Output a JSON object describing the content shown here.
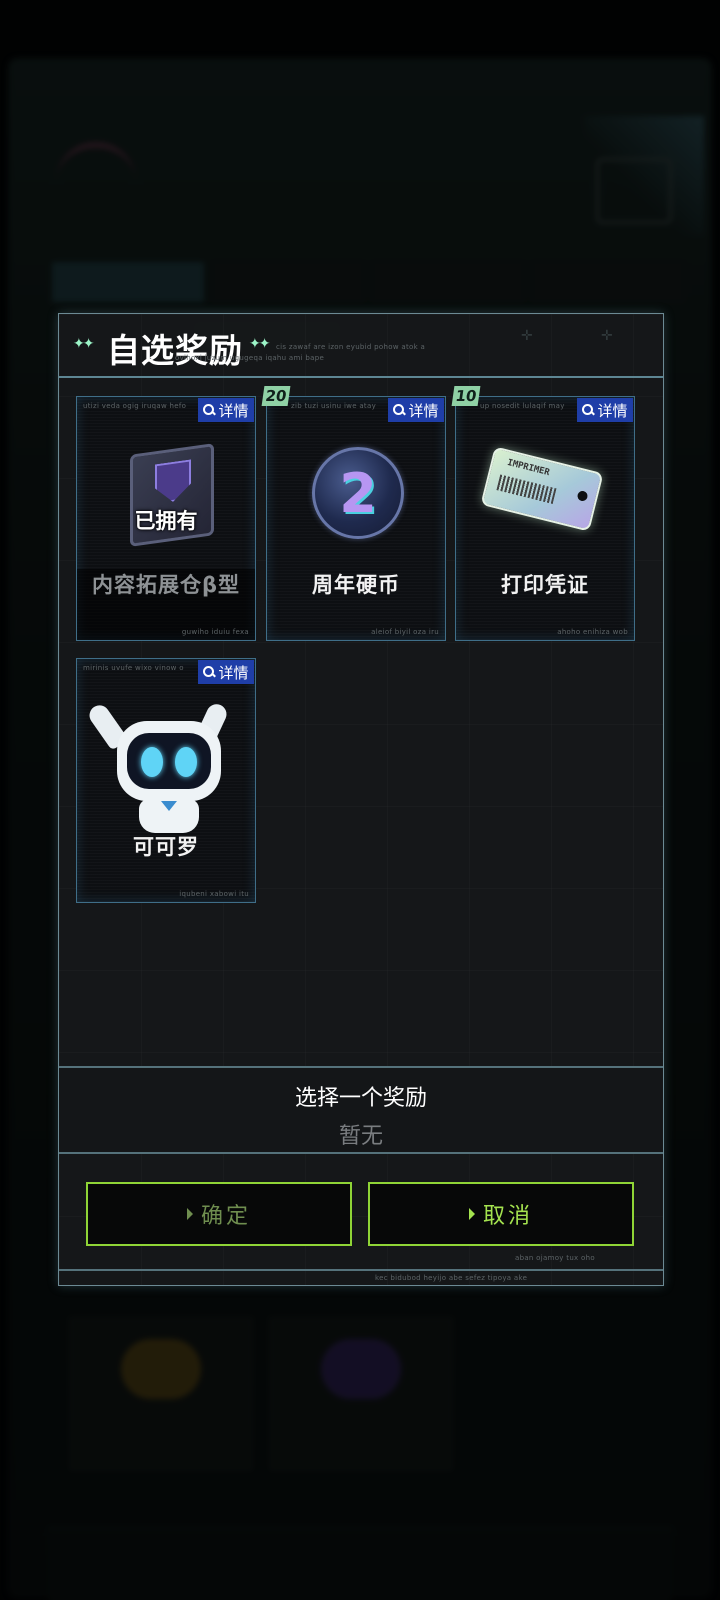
{
  "dialog": {
    "title": "自选奖励",
    "title_deco_left": "✦✦",
    "title_deco_right": "✦✦",
    "header_deco_line1": "cis zawaf are izon eyubid pohow atok a",
    "header_deco_line2": "ovihoxi juzum ugugeqa iqahu ami bape",
    "detail_label": "详情",
    "rewards": [
      {
        "name": "内容拓展仓β型",
        "status": "已拥有",
        "deco_top": "utizi veda ogig iruqaw hefo",
        "deco_bottom": "guwiho iduiu fexa"
      },
      {
        "name": "周年硬币",
        "quantity": "20",
        "coin_glyph": "2",
        "deco_top": "zib tuzi usinu iwe atay",
        "deco_bottom": "aleiof biyil oza iru"
      },
      {
        "name": "打印凭证",
        "quantity": "10",
        "ticket_text": "IMPRIMER",
        "deco_top": "up nosedit lulaqif may",
        "deco_bottom": "ahoho enihiza wob"
      },
      {
        "name": "可可罗",
        "deco_top": "mirinis uvufe wixo vinow o",
        "deco_bottom": "iqubeni xabowi itu"
      }
    ],
    "selection": {
      "label": "选择一个奖励",
      "value": "暂无"
    },
    "buttons": {
      "confirm": "确定",
      "cancel": "取消"
    },
    "footer_deco_line1": "aban ojamoy tux oho",
    "footer_deco_line2": "kec bidubod heyijo abe sefez tipoya ake"
  },
  "colors": {
    "accent_green": "#a4e34f",
    "border_cyan": "#6c8a94",
    "detail_blue": "#1f3ea8",
    "quantity_badge": "#8fd1a5"
  },
  "icons": {
    "detail": "magnifier-icon",
    "sparkles": "sparkle-icon",
    "button_arrow": "triangle-right-icon"
  }
}
